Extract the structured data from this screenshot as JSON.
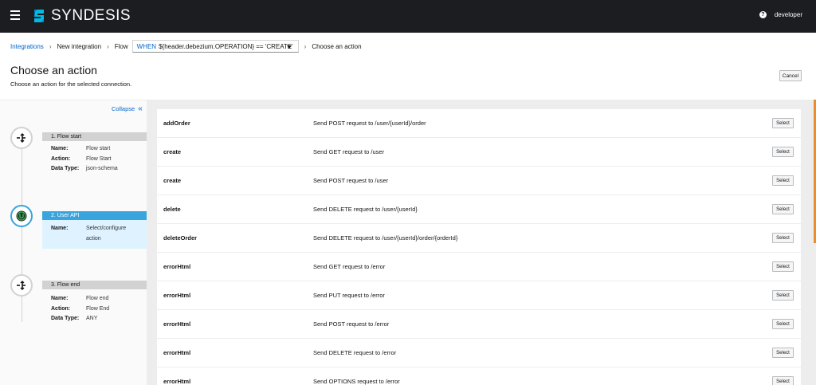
{
  "app": {
    "brand": "SYNDESIS",
    "user": "developer",
    "help_glyph": "?"
  },
  "breadcrumb": {
    "items": [
      "Integrations",
      "New integration",
      "Flow"
    ],
    "flow_when": "WHEN",
    "flow_condition": "${header.debezium.OPERATION} == 'CREATE'",
    "current": "Choose an action",
    "separator": "›"
  },
  "header": {
    "title": "Choose an action",
    "subtitle": "Choose an action for the selected connection.",
    "cancel_label": "Cancel"
  },
  "sidebar": {
    "collapse_label": "Collapse",
    "collapse_glyph": "«",
    "steps": [
      {
        "label": "1. Flow start",
        "icon": "flow-icon",
        "details": [
          {
            "k": "Name:",
            "v": "Flow start"
          },
          {
            "k": "Action:",
            "v": "Flow Start"
          },
          {
            "k": "Data Type:",
            "v": "json-schema"
          }
        ]
      },
      {
        "label": "2. User API",
        "icon": "api-connector-icon",
        "details": [
          {
            "k": "Name:",
            "v": "Select/configure"
          },
          {
            "k": "",
            "v": "action"
          }
        ]
      },
      {
        "label": "3. Flow end",
        "icon": "flow-icon",
        "details": [
          {
            "k": "Name:",
            "v": "Flow end"
          },
          {
            "k": "Action:",
            "v": "Flow End"
          },
          {
            "k": "Data Type:",
            "v": "ANY"
          }
        ]
      }
    ]
  },
  "actions": {
    "select_label": "Select",
    "rows": [
      {
        "name": "addOrder",
        "desc": "Send POST request to /user/{userId}/order"
      },
      {
        "name": "create",
        "desc": "Send GET request to /user"
      },
      {
        "name": "create",
        "desc": "Send POST request to /user"
      },
      {
        "name": "delete",
        "desc": "Send DELETE request to /user/{userId}"
      },
      {
        "name": "deleteOrder",
        "desc": "Send DELETE request to /user/{userId}/order/{orderId}"
      },
      {
        "name": "errorHtml",
        "desc": "Send GET request to /error"
      },
      {
        "name": "errorHtml",
        "desc": "Send PUT request to /error"
      },
      {
        "name": "errorHtml",
        "desc": "Send POST request to /error"
      },
      {
        "name": "errorHtml",
        "desc": "Send DELETE request to /error"
      },
      {
        "name": "errorHtml",
        "desc": "Send OPTIONS request to /error"
      }
    ]
  },
  "colors": {
    "topbar": "#1b1d21",
    "link": "#0066cc",
    "active_step": "#39a5dc",
    "active_step_bg": "#def3ff",
    "scrollbar": "#ec7a08"
  }
}
